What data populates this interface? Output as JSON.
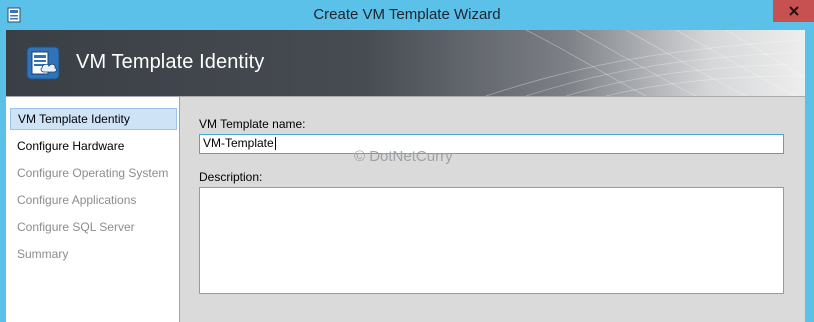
{
  "window": {
    "title": "Create VM Template Wizard"
  },
  "header": {
    "title": "VM Template Identity",
    "icon": "vm-template-icon"
  },
  "nav": {
    "items": [
      {
        "label": "VM Template Identity",
        "state": "selected"
      },
      {
        "label": "Configure Hardware",
        "state": "enabled"
      },
      {
        "label": "Configure Operating System",
        "state": "disabled"
      },
      {
        "label": "Configure Applications",
        "state": "disabled"
      },
      {
        "label": "Configure SQL Server",
        "state": "disabled"
      },
      {
        "label": "Summary",
        "state": "disabled"
      }
    ]
  },
  "form": {
    "name_label": "VM Template name:",
    "name_value": "VM-Template",
    "description_label": "Description:",
    "description_value": ""
  },
  "watermark": "© DotNetCurry",
  "colors": {
    "titlebar": "#5cc1e8",
    "close_button": "#c75050",
    "selection": "#cfe3f6",
    "input_border": "#4aa6d4"
  }
}
